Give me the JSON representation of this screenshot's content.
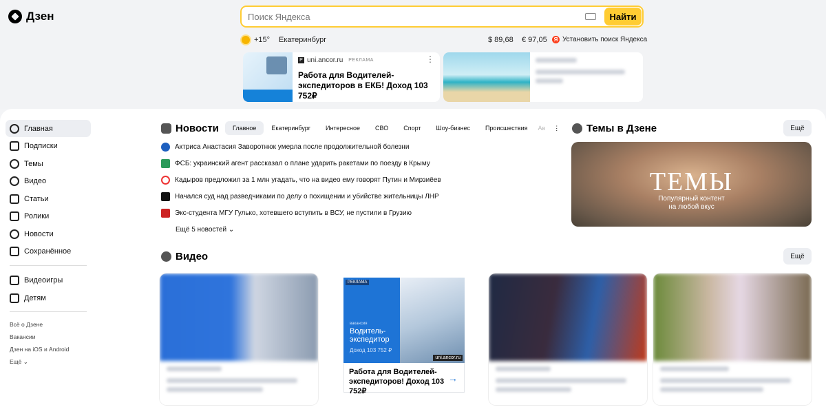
{
  "logo": {
    "text": "Дзен"
  },
  "search": {
    "placeholder": "Поиск Яндекса",
    "button": "Найти"
  },
  "info": {
    "temp": "+15°",
    "city": "Екатеринбург",
    "usd": "$ 89,68",
    "eur": "€ 97,05",
    "install": "Установить поиск Яндекса"
  },
  "ads": {
    "first": {
      "domain": "uni.ancor.ru",
      "label": "РЕКЛАМА",
      "title": "Работа для Водителей-экспедиторов в ЕКБ! Доход 103 752₽"
    }
  },
  "nav": {
    "items": [
      "Главная",
      "Подписки",
      "Темы",
      "Видео",
      "Статьи",
      "Ролики",
      "Новости",
      "Сохранённое"
    ],
    "items2": [
      "Видеоигры",
      "Детям"
    ],
    "footer": [
      "Всё о Дзене",
      "Вакансии",
      "Дзен на iOS и Android",
      "Ещё"
    ]
  },
  "news": {
    "title": "Новости",
    "tabs": [
      "Главное",
      "Екатеринбург",
      "Интересное",
      "СВО",
      "Спорт",
      "Шоу-бизнес",
      "Происшествия",
      "Ав"
    ],
    "items": [
      "Актриса Анастасия Заворотнюк умерла после продолжительной болезни",
      "ФСБ: украинский агент рассказал о плане ударить ракетами по поезду в Крыму",
      "Кадыров предложил за 1 млн угадать, что на видео ему говорят Путин и Мирзиёев",
      "Начался суд над разведчиками по делу о похищении и убийстве жительницы ЛНР",
      "Экс-студента МГУ Гулько, хотевшего вступить в ВСУ, не пустили в Грузию"
    ],
    "more": "Ещё 5 новостей"
  },
  "themes": {
    "title": "Темы в Дзене",
    "more": "Ещё",
    "card_title": "ТЕМЫ",
    "card_sub1": "Популярный контент",
    "card_sub2": "на любой вкус"
  },
  "video": {
    "title": "Видео",
    "more": "Ещё"
  },
  "video_ad": {
    "tag": "РЕКЛАМА",
    "vacancy": "вакансия",
    "headline": "Водитель-экспедитор",
    "pay": "Доход 103 752 ₽",
    "domain": "uni.ancor.ru",
    "caption": "Работа для Водителей-экспедиторов! Доход 103 752₽"
  },
  "colors": {
    "accent": "#ffcc33",
    "brand_red": "#fc3f1d",
    "link_blue": "#1e74d6"
  }
}
